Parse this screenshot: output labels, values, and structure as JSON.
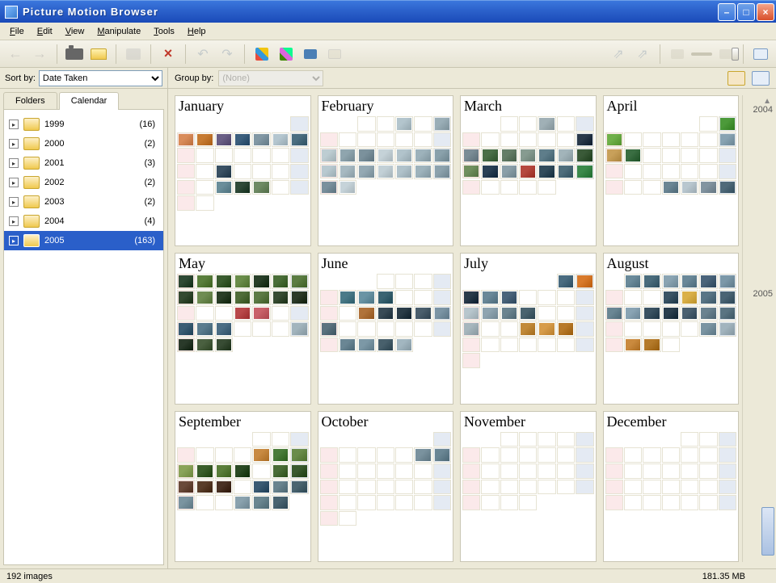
{
  "window": {
    "title": "Picture Motion Browser"
  },
  "menu": {
    "items": [
      "File",
      "Edit",
      "View",
      "Manipulate",
      "Tools",
      "Help"
    ]
  },
  "toolbar": {
    "items": [
      {
        "name": "back",
        "icon": "arrow-left",
        "disabled": true
      },
      {
        "name": "forward",
        "icon": "arrow-right",
        "disabled": true
      },
      {
        "name": "sep"
      },
      {
        "name": "import-camera",
        "icon": "camera"
      },
      {
        "name": "import-folder",
        "icon": "folder"
      },
      {
        "name": "sep"
      },
      {
        "name": "print",
        "icon": "printer",
        "disabled": true
      },
      {
        "name": "sep"
      },
      {
        "name": "delete",
        "icon": "x"
      },
      {
        "name": "sep"
      },
      {
        "name": "rotate-left",
        "icon": "rot-ccw",
        "disabled": true
      },
      {
        "name": "rotate-right",
        "icon": "rot-cw",
        "disabled": true
      },
      {
        "name": "sep"
      },
      {
        "name": "edit",
        "icon": "brush"
      },
      {
        "name": "decorate",
        "icon": "brush2"
      },
      {
        "name": "slideshow",
        "icon": "slide"
      },
      {
        "name": "mail",
        "icon": "mail",
        "disabled": true
      },
      {
        "name": "spacer"
      },
      {
        "name": "export1",
        "icon": "export",
        "disabled": true
      },
      {
        "name": "export2",
        "icon": "export",
        "disabled": true
      },
      {
        "name": "sep"
      },
      {
        "name": "zoom-out",
        "icon": "chip",
        "disabled": true
      },
      {
        "name": "slider",
        "icon": "slider"
      },
      {
        "name": "zoom-in",
        "icon": "chip",
        "disabled": true
      },
      {
        "name": "sep"
      },
      {
        "name": "view-mode",
        "icon": "view"
      }
    ]
  },
  "sidebar": {
    "sort_label": "Sort by:",
    "sort_value": "Date Taken",
    "tabs": {
      "folders": "Folders",
      "calendar": "Calendar"
    },
    "active_tab": "Calendar",
    "years": [
      {
        "year": "1999",
        "count": "(16)"
      },
      {
        "year": "2000",
        "count": "(2)"
      },
      {
        "year": "2001",
        "count": "(3)"
      },
      {
        "year": "2002",
        "count": "(2)"
      },
      {
        "year": "2003",
        "count": "(2)"
      },
      {
        "year": "2004",
        "count": "(4)"
      },
      {
        "year": "2005",
        "count": "(163)",
        "selected": true
      }
    ]
  },
  "main": {
    "group_label": "Group by:",
    "group_value": "(None)"
  },
  "timeline": {
    "prev_year": "2004",
    "current_year": "2005"
  },
  "months": [
    {
      "name": "January",
      "start": 6,
      "days": 31,
      "thumbs": {
        "2": "#d98c5a",
        "3": "#c77b32",
        "4": "#6a5f85",
        "5": "#3c5f7d",
        "6": "#8298a4",
        "7": "#b4c6cf",
        "8": "#4b6e80",
        "18": "#3a5163",
        "25": "#6a8e9a",
        "26": "#2f4a38",
        "27": "#6e8a64"
      }
    },
    {
      "name": "February",
      "start": 2,
      "days": 28,
      "thumbs": {
        "3": "#b3c5cd",
        "5": "#9aaeb7",
        "13": "#bdcdd2",
        "14": "#8fa5ae",
        "15": "#7b919c",
        "16": "#c5d2d8",
        "17": "#b1c3cb",
        "18": "#9db2bb",
        "19": "#8aa1ab",
        "20": "#b8c9d0",
        "21": "#a6b9c1",
        "22": "#94a9b3",
        "23": "#c2d0d6",
        "24": "#b0c2ca",
        "25": "#9eb3bc",
        "26": "#8ca2ad",
        "27": "#7a919d",
        "28": "#c6d3d9"
      }
    },
    {
      "name": "March",
      "start": 2,
      "days": 31,
      "thumbs": {
        "3": "#a0b0b6",
        "12": "#2a394a",
        "13": "#7a8c96",
        "14": "#4a6f48",
        "15": "#647d66",
        "16": "#869b90",
        "17": "#5e7d8a",
        "18": "#a2b4ba",
        "19": "#3a5a38",
        "20": "#6f8f5e",
        "21": "#294055",
        "22": "#8a9fa8",
        "23": "#b5483e",
        "24": "#324c5c",
        "25": "#4f6e7b",
        "26": "#3c8a4a"
      }
    },
    {
      "name": "April",
      "start": 5,
      "days": 30,
      "thumbs": {
        "2": "#4c9a3a",
        "3": "#6fb04a",
        "9": "#88a3b2",
        "10": "#c8a05a",
        "11": "#3a6e42",
        "29": "#8294a0",
        "30": "#4f6a7a",
        "28": "#b9c7cf",
        "27": "#6b8694"
      }
    },
    {
      "name": "May",
      "start": 0,
      "days": 31,
      "thumbs": {
        "1": "#2e4a34",
        "2": "#5a7f3c",
        "3": "#3a5c2e",
        "4": "#6a8d4a",
        "5": "#283f28",
        "6": "#4a6e38",
        "7": "#5c7d42",
        "8": "#344a30",
        "9": "#6f8c52",
        "10": "#2a3e26",
        "11": "#4f6c38",
        "12": "#5c7a44",
        "13": "#384c32",
        "14": "#2c3a28",
        "18": "#b9484a",
        "19": "#c9626a",
        "22": "#3a5e74",
        "23": "#5a7c8e",
        "24": "#4b6d84",
        "28": "#a2b4bd",
        "29": "#2a3a2a",
        "30": "#4a6040",
        "31": "#384c34"
      }
    },
    {
      "name": "June",
      "start": 3,
      "days": 30,
      "thumbs": {
        "6": "#4a7a88",
        "7": "#6a94a4",
        "8": "#3a6472",
        "14": "#b0723a",
        "15": "#384a56",
        "16": "#2a3c48",
        "17": "#4a5e6c",
        "18": "#7b94a4",
        "19": "#5a727e",
        "27": "#6a8694",
        "28": "#7c98a6",
        "29": "#48606c",
        "30": "#a2b6c0"
      }
    },
    {
      "name": "July",
      "start": 5,
      "days": 31,
      "thumbs": {
        "1": "#4a6c80",
        "2": "#d97a2a",
        "3": "#2a3a4a",
        "4": "#6a8898",
        "5": "#4a647a",
        "10": "#b8c6cd",
        "11": "#8ea4b0",
        "12": "#6a838f",
        "13": "#4a636f",
        "17": "#a6b6bd",
        "20": "#c28a3a",
        "21": "#d79c4a",
        "22": "#b87a2a"
      }
    },
    {
      "name": "August",
      "start": 1,
      "days": 31,
      "thumbs": {
        "1": "#6a8a9a",
        "2": "#4a6c7c",
        "3": "#8aa4b2",
        "4": "#6a8898",
        "5": "#4a647a",
        "6": "#7c98a8",
        "10": "#3a5464",
        "11": "#dab048",
        "12": "#5a7686",
        "13": "#4a6474",
        "14": "#6a8694",
        "15": "#8aa4b4",
        "16": "#3a5262",
        "17": "#2a3e4c",
        "18": "#4a6070",
        "19": "#6a8290",
        "20": "#5a7482",
        "26": "#7a94a2",
        "27": "#a2b4be",
        "29": "#ca8a3e",
        "30": "#b47a2a"
      }
    },
    {
      "name": "September",
      "start": 4,
      "days": 30,
      "thumbs": {
        "8": "#c88a42",
        "9": "#4a7c3a",
        "10": "#6a8c4a",
        "11": "#8aa45a",
        "12": "#3a5e2a",
        "13": "#5a7e3a",
        "14": "#2a4a24",
        "16": "#4a6c36",
        "17": "#3a5a2e",
        "18": "#6a4a3a",
        "19": "#5a3e2a",
        "20": "#4a3224",
        "22": "#3a5a72",
        "23": "#6a848e",
        "24": "#4a6470",
        "25": "#7a94a0",
        "28": "#8aa2ae",
        "29": "#6a8690",
        "30": "#4a6470"
      }
    },
    {
      "name": "October",
      "start": 6,
      "days": 31,
      "thumbs": {
        "7": "#7a929e",
        "8": "#6a8694"
      }
    },
    {
      "name": "November",
      "start": 2,
      "days": 30,
      "thumbs": {}
    },
    {
      "name": "December",
      "start": 4,
      "days": 31,
      "thumbs": {}
    }
  ],
  "status": {
    "left": "192 images",
    "right": "181.35 MB"
  }
}
